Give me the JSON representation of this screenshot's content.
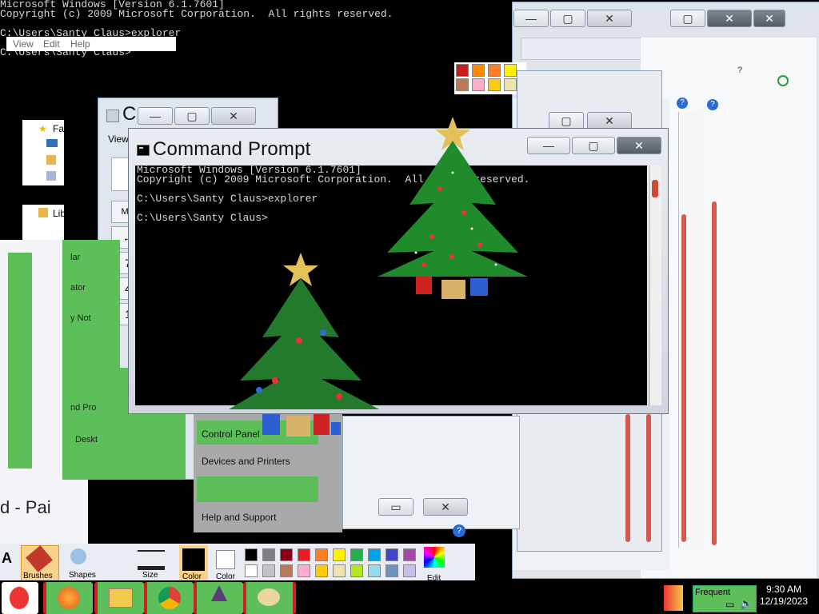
{
  "console": {
    "line1": "Microsoft Windows [Version 6.1.7601]",
    "line2": "Copyright (c) 2009 Microsoft Corporation.  All rights reserved.",
    "line3": "C:\\Users\\Santy Claus>explorer",
    "line4": "C:\\Users\\Santy Claus>"
  },
  "menubar_ghost": {
    "items": [
      "View",
      "Edit",
      "Help"
    ]
  },
  "cmd": {
    "title": "Command Prompt",
    "text": "Microsoft Windows [Version 6.1.7601]\nCopyright (c) 2009 Microsoft Corporation.  All rights reserved.\n\nC:\\Users\\Santy Claus>explorer\n\nC:\\Users\\Santy Claus>"
  },
  "calc_ghost": {
    "title": "C",
    "view_label": "View",
    "mc_label": "MC",
    "back_label": "←",
    "digits": [
      "7",
      "4",
      "1"
    ]
  },
  "explorer_ghost": {
    "favorites": "Fa",
    "libraries": "Lib"
  },
  "start_menu": {
    "items": [
      "Control Panel",
      "Devices and Printers",
      "Help and Support"
    ]
  },
  "side_ghost_labels": [
    "lar",
    "ator",
    "y Not",
    "nd Pro",
    "Deskt"
  ],
  "paint": {
    "title_fragment": "d - Pai",
    "brushes": "Brushes",
    "shapes": "Shapes",
    "size": "Size",
    "color": "Color",
    "color2": "Color",
    "edit": "Edit",
    "tool_a": "A"
  },
  "help_q": "?",
  "tray": {
    "time": "9:30 AM",
    "date": "12/19/2023",
    "frequent": "Frequent"
  },
  "palette_colors": [
    "#000000",
    "#7f7f7f",
    "#880015",
    "#ed1c24",
    "#ff7f27",
    "#fff200",
    "#22b14c",
    "#00a2e8",
    "#3f48cc",
    "#a349a4",
    "#ffffff",
    "#c3c3c3",
    "#b97a57",
    "#ffaec9",
    "#ffc90e",
    "#efe4b0",
    "#b5e61d",
    "#99d9ea",
    "#7092be",
    "#c8bfe7"
  ],
  "mini_palette": [
    "#c81e1e",
    "#ff8c00",
    "#fff200",
    "#b97a57",
    "#ffaec9",
    "#ffc90e"
  ],
  "taskbar_apps": [
    "santa-icon",
    "firefox-icon",
    "file-explorer-icon",
    "chrome-icon",
    "wizard-icon",
    "paint-icon"
  ]
}
